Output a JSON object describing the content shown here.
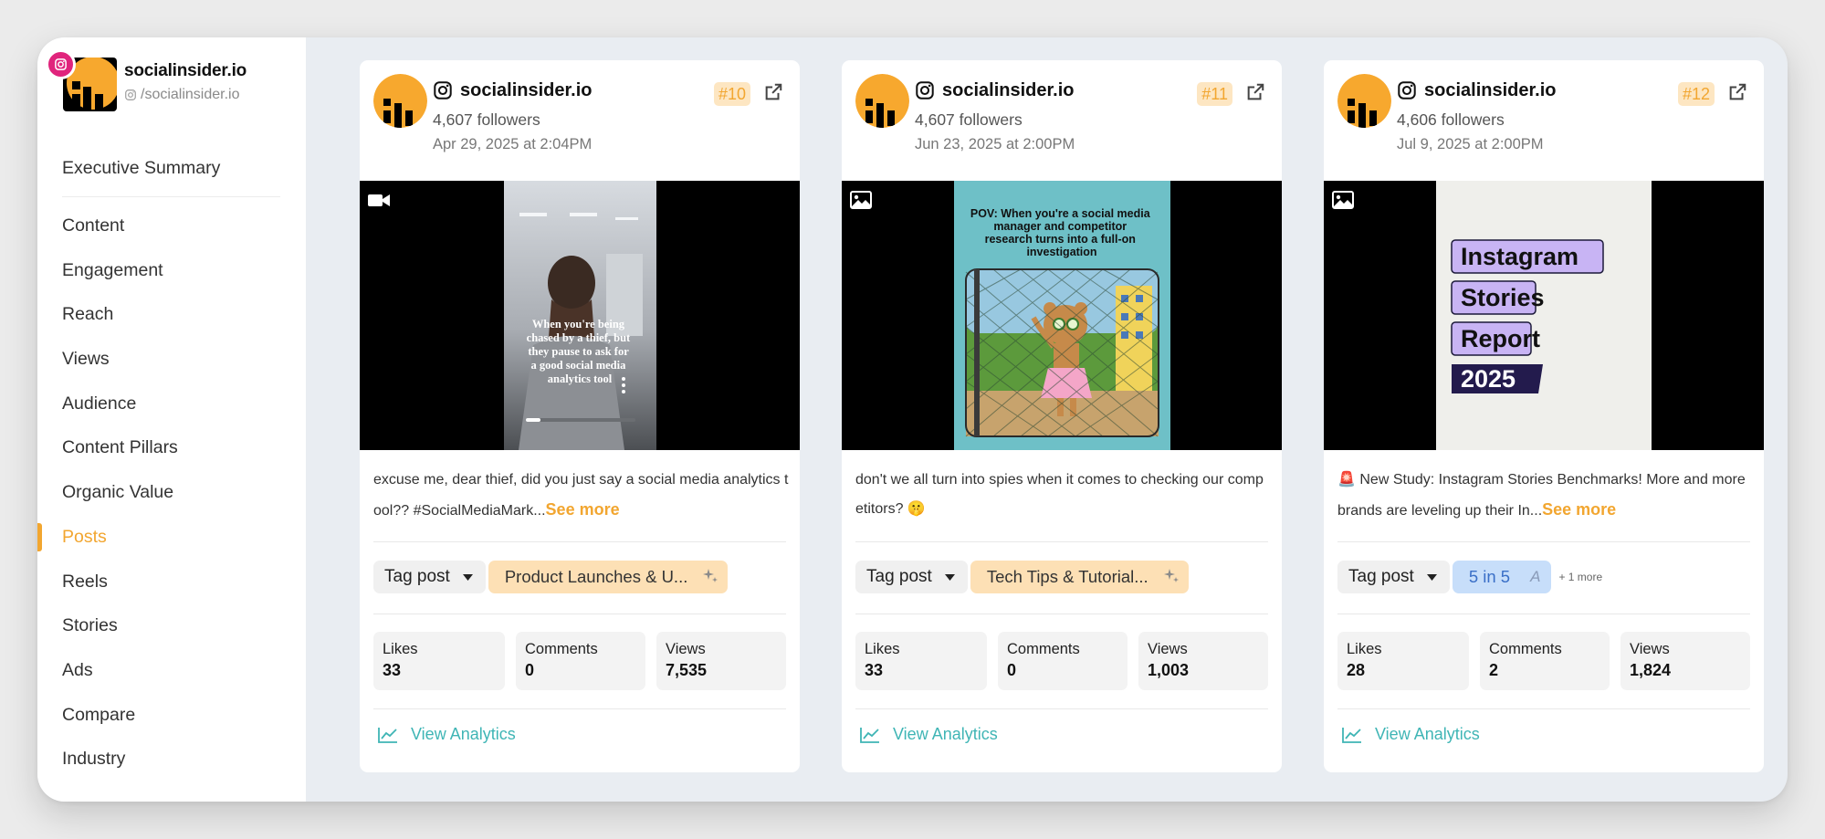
{
  "brand": {
    "name": "socialinsider.io",
    "handle": "/socialinsider.io",
    "platform_icon": "instagram-icon",
    "accent": "#f2a630",
    "badge_color": "#e0247c"
  },
  "sidebar": {
    "summary": "Executive Summary",
    "items": [
      {
        "label": "Content"
      },
      {
        "label": "Engagement"
      },
      {
        "label": "Reach"
      },
      {
        "label": "Views"
      },
      {
        "label": "Audience"
      },
      {
        "label": "Content Pillars"
      },
      {
        "label": "Organic Value"
      },
      {
        "label": "Posts"
      },
      {
        "label": "Reels"
      },
      {
        "label": "Stories"
      },
      {
        "label": "Ads"
      },
      {
        "label": "Compare"
      },
      {
        "label": "Industry"
      }
    ],
    "active": "Posts"
  },
  "posts": [
    {
      "account": "socialinsider.io",
      "followers": "4,607 followers",
      "date": "Apr 29, 2025 at 2:04PM",
      "rank": "#10",
      "media_type_icon": "video-camera-icon",
      "media_overlay_text": "When you're being chased by a thief, but they pause to ask for a good social media analytics tool",
      "caption": "excuse me, dear thief, did you just say a social media analytics tool?? #SocialMediaMark...",
      "see_more": "See more",
      "tag_button": "Tag post",
      "pillar_tag": "Product Launches & U...",
      "likes_label": "Likes",
      "likes": "33",
      "comments_label": "Comments",
      "comments": "0",
      "views_label": "Views",
      "views": "7,535",
      "view_analytics": "View Analytics"
    },
    {
      "account": "socialinsider.io",
      "followers": "4,607 followers",
      "date": "Jun 23, 2025 at 2:00PM",
      "rank": "#11",
      "media_type_icon": "image-icon",
      "media_overlay_text": "POV: When you're a social media manager and competitor research turns into a full-on investigation",
      "caption": "don't we all turn into spies when it comes to checking our competitors? 🤫",
      "tag_button": "Tag post",
      "pillar_tag": "Tech Tips & Tutorial...",
      "likes_label": "Likes",
      "likes": "33",
      "comments_label": "Comments",
      "comments": "0",
      "views_label": "Views",
      "views": "1,003",
      "view_analytics": "View Analytics"
    },
    {
      "account": "socialinsider.io",
      "followers": "4,606 followers",
      "date": "Jul 9, 2025 at 2:00PM",
      "rank": "#12",
      "media_type_icon": "image-icon",
      "media_lines": [
        "Instagram",
        "Stories",
        "Report",
        "2025"
      ],
      "caption": "🚨 New Study: Instagram Stories Benchmarks! More and more brands are leveling up their In...",
      "see_more": "See more",
      "tag_button": "Tag post",
      "pillar_tag": "5 in 5",
      "ai_letter": "A",
      "more_tags": "+ 1 more",
      "likes_label": "Likes",
      "likes": "28",
      "comments_label": "Comments",
      "comments": "2",
      "views_label": "Views",
      "views": "1,824",
      "view_analytics": "View Analytics"
    }
  ]
}
